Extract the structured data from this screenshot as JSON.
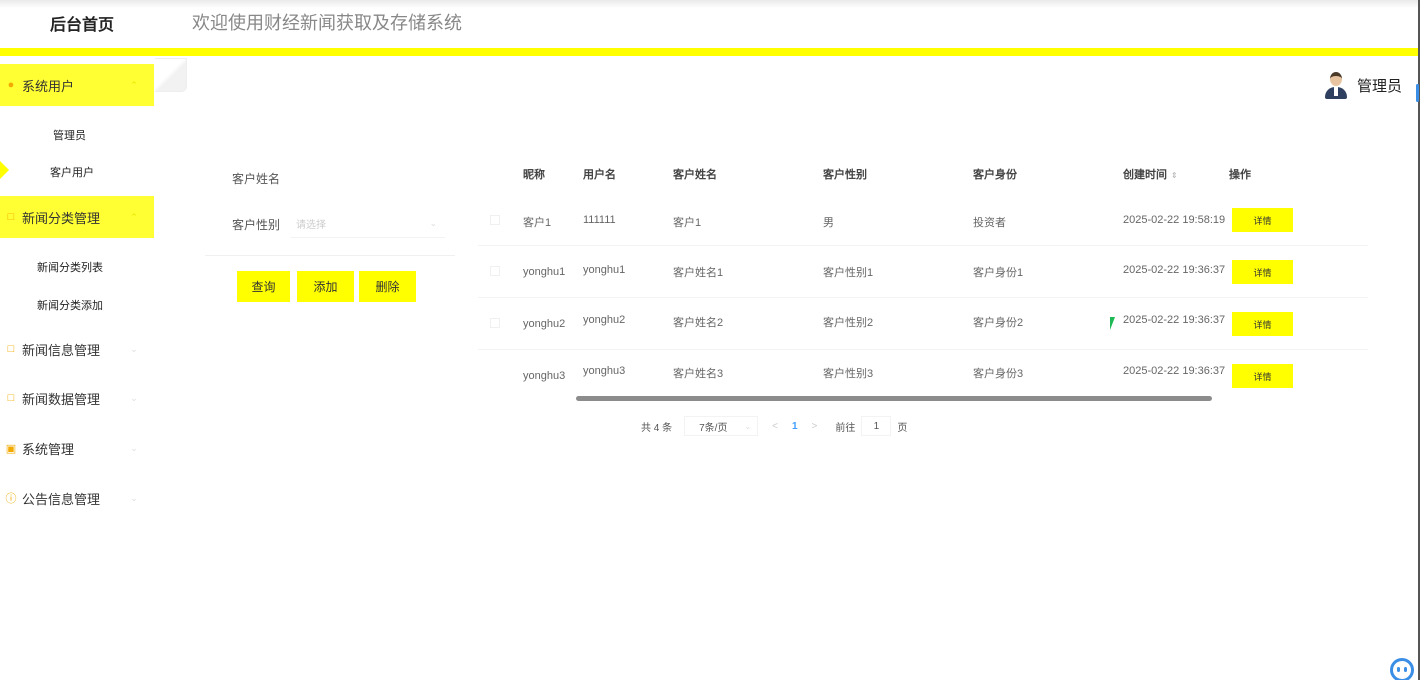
{
  "header": {
    "brand": "后台首页",
    "welcome": "欢迎使用财经新闻获取及存储系统"
  },
  "user": {
    "name": "管理员"
  },
  "sidebar": {
    "groups": [
      {
        "label": "系统用户",
        "icon": "user-icon",
        "expanded": true,
        "active": true
      },
      {
        "label": "新闻分类管理",
        "icon": "folder-icon",
        "expanded": true,
        "active": true
      },
      {
        "label": "新闻信息管理",
        "icon": "folder-icon",
        "expanded": false
      },
      {
        "label": "新闻数据管理",
        "icon": "folder-icon",
        "expanded": false
      },
      {
        "label": "系统管理",
        "icon": "settings-icon",
        "expanded": false
      },
      {
        "label": "公告信息管理",
        "icon": "info-icon",
        "expanded": false
      }
    ],
    "sub_items": {
      "system_users": [
        "管理员",
        "客户用户"
      ],
      "news_category": [
        "新闻分类列表",
        "新闻分类添加"
      ]
    },
    "selected": "客户用户"
  },
  "search": {
    "name_label": "客户姓名",
    "gender_label": "客户性别",
    "gender_placeholder": "请选择",
    "buttons": {
      "query": "查询",
      "add": "添加",
      "delete": "删除"
    }
  },
  "table": {
    "columns": [
      "昵称",
      "用户名",
      "客户姓名",
      "客户性别",
      "客户身份",
      "创建时间",
      "操作"
    ],
    "rows": [
      [
        "客户1",
        "111111",
        "客户1",
        "男",
        "投资者",
        "2025-02-22 19:58:19"
      ],
      [
        "yonghu1",
        "yonghu1",
        "客户姓名1",
        "客户性别1",
        "客户身份1",
        "2025-02-22 19:36:37"
      ],
      [
        "yonghu2",
        "yonghu2",
        "客户姓名2",
        "客户性别2",
        "客户身份2",
        "2025-02-22 19:36:37"
      ],
      [
        "yonghu3",
        "yonghu3",
        "客户姓名3",
        "客户性别3",
        "客户身份3",
        "2025-02-22 19:36:37"
      ]
    ],
    "detail_label": "详情"
  },
  "pagination": {
    "total": "共 4 条",
    "page_size": "7条/页",
    "prev": "<",
    "current": "1",
    "next": ">",
    "goto_prefix": "前往",
    "goto_value": "1",
    "goto_suffix": "页"
  }
}
